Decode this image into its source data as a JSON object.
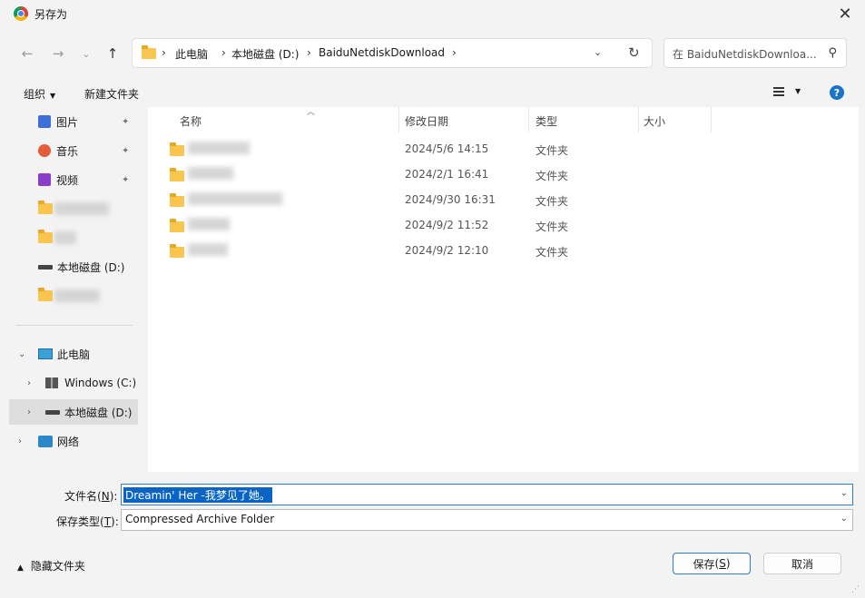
{
  "window": {
    "title": "另存为"
  },
  "address": {
    "crumbs": [
      "此电脑",
      "本地磁盘 (D:)",
      "BaiduNetdiskDownload"
    ],
    "separator": "›"
  },
  "search": {
    "placeholder": "在 BaiduNetdiskDownloa..."
  },
  "toolbar": {
    "organize_label": "组织",
    "new_folder_label": "新建文件夹",
    "help_label": "?"
  },
  "nav": {
    "quick_access": [
      {
        "label": "图片",
        "icon": "image-icon"
      },
      {
        "label": "音乐",
        "icon": "music-icon"
      },
      {
        "label": "视频",
        "icon": "video-icon"
      },
      {
        "label": "",
        "icon": "folder-icon"
      },
      {
        "label": "",
        "icon": "folder-icon"
      },
      {
        "label": "本地磁盘 (D:)",
        "icon": "drive-icon"
      },
      {
        "label": "",
        "icon": "folder-icon"
      }
    ],
    "tree": [
      {
        "label": "此电脑",
        "icon": "computer-icon"
      },
      {
        "label": "Windows (C:)",
        "icon": "windows-drive-icon"
      },
      {
        "label": "本地磁盘 (D:)",
        "icon": "drive-icon"
      },
      {
        "label": "网络",
        "icon": "network-icon"
      }
    ]
  },
  "columns": {
    "name": "名称",
    "date": "修改日期",
    "type": "类型",
    "size": "大小"
  },
  "files": [
    {
      "date": "2024/5/6 14:15",
      "type": "文件夹"
    },
    {
      "date": "2024/2/1 16:41",
      "type": "文件夹"
    },
    {
      "date": "2024/9/30 16:31",
      "type": "文件夹"
    },
    {
      "date": "2024/9/2 11:52",
      "type": "文件夹"
    },
    {
      "date": "2024/9/2 12:10",
      "type": "文件夹"
    }
  ],
  "form": {
    "filename_label": "文件名",
    "filename_key": "N",
    "filename_value": "Dreamin' Her -我梦见了她。",
    "filetype_label": "保存类型",
    "filetype_key": "T",
    "filetype_value": "Compressed Archive Folder"
  },
  "footer": {
    "hide_folders_label": "隐藏文件夹",
    "save_label": "保存",
    "save_key": "S",
    "cancel_label": "取消"
  }
}
